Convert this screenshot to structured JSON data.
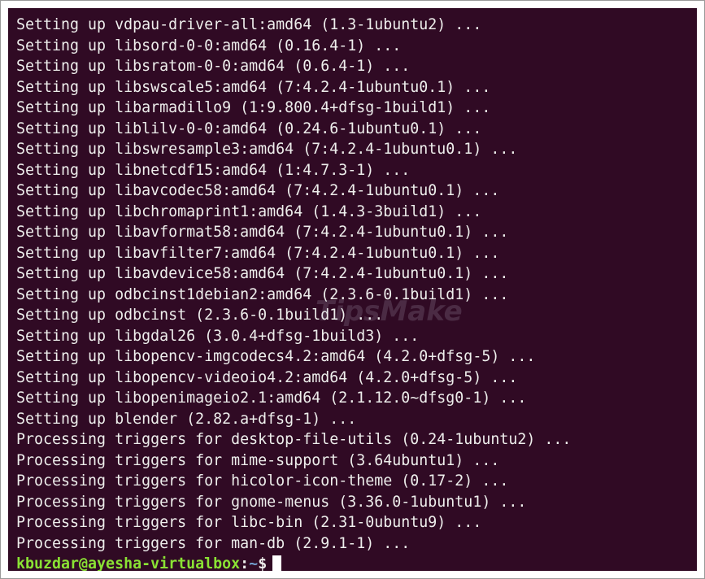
{
  "terminal": {
    "lines": [
      "Setting up vdpau-driver-all:amd64 (1.3-1ubuntu2) ...",
      "Setting up libsord-0-0:amd64 (0.16.4-1) ...",
      "Setting up libsratom-0-0:amd64 (0.6.4-1) ...",
      "Setting up libswscale5:amd64 (7:4.2.4-1ubuntu0.1) ...",
      "Setting up libarmadillo9 (1:9.800.4+dfsg-1build1) ...",
      "Setting up liblilv-0-0:amd64 (0.24.6-1ubuntu0.1) ...",
      "Setting up libswresample3:amd64 (7:4.2.4-1ubuntu0.1) ...",
      "Setting up libnetcdf15:amd64 (1:4.7.3-1) ...",
      "Setting up libavcodec58:amd64 (7:4.2.4-1ubuntu0.1) ...",
      "Setting up libchromaprint1:amd64 (1.4.3-3build1) ...",
      "Setting up libavformat58:amd64 (7:4.2.4-1ubuntu0.1) ...",
      "Setting up libavfilter7:amd64 (7:4.2.4-1ubuntu0.1) ...",
      "Setting up libavdevice58:amd64 (7:4.2.4-1ubuntu0.1) ...",
      "Setting up odbcinst1debian2:amd64 (2.3.6-0.1build1) ...",
      "Setting up odbcinst (2.3.6-0.1build1) ...",
      "Setting up libgdal26 (3.0.4+dfsg-1build3) ...",
      "Setting up libopencv-imgcodecs4.2:amd64 (4.2.0+dfsg-5) ...",
      "Setting up libopencv-videoio4.2:amd64 (4.2.0+dfsg-5) ...",
      "Setting up libopenimageio2.1:amd64 (2.1.12.0~dfsg0-1) ...",
      "Setting up blender (2.82.a+dfsg-1) ...",
      "Processing triggers for desktop-file-utils (0.24-1ubuntu2) ...",
      "Processing triggers for mime-support (3.64ubuntu1) ...",
      "Processing triggers for hicolor-icon-theme (0.17-2) ...",
      "Processing triggers for gnome-menus (3.36.0-1ubuntu1) ...",
      "Processing triggers for libc-bin (2.31-0ubuntu9) ...",
      "Processing triggers for man-db (2.9.1-1) ..."
    ],
    "prompt": {
      "user_host": "kbuzdar@ayesha-virtualbox",
      "separator": ":",
      "cwd": "~",
      "symbol": "$"
    },
    "watermark": "TipsMake",
    "colors": {
      "background": "#300a24",
      "text": "#eeeeec",
      "prompt_user": "#8ae234",
      "prompt_path": "#729fcf"
    }
  }
}
